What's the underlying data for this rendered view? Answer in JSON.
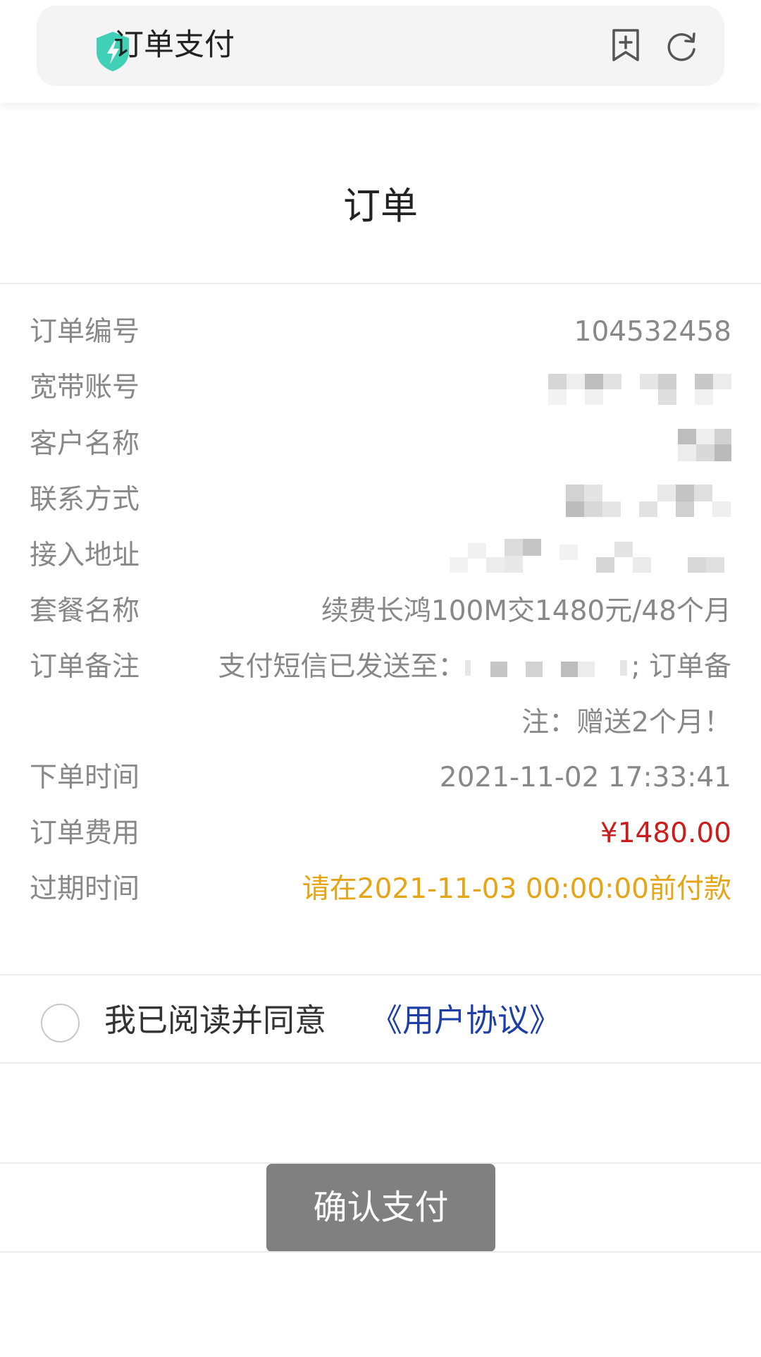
{
  "browser": {
    "page_title": "订单支付"
  },
  "order": {
    "heading": "订单",
    "fields": [
      {
        "label": "订单编号",
        "value": "104532458"
      },
      {
        "label": "宽带账号",
        "value": ""
      },
      {
        "label": "客户名称",
        "value": ""
      },
      {
        "label": "联系方式",
        "value": ""
      },
      {
        "label": "接入地址",
        "value": ""
      },
      {
        "label": "套餐名称",
        "value": "续费长鸿100M交1480元/48个月"
      },
      {
        "label": "订单备注",
        "value_line1_prefix": "支付短信已发送至：",
        "value_line1_suffix": "; 订单备",
        "value_line2": "注：赠送2个月！"
      },
      {
        "label": "下单时间",
        "value": "2021-11-02 17:33:41"
      },
      {
        "label": "订单费用",
        "value": "¥1480.00"
      },
      {
        "label": "过期时间",
        "value": "请在2021-11-03 00:00:00前付款"
      }
    ]
  },
  "agreement": {
    "text": "我已阅读并同意",
    "link": "《用户协议》"
  },
  "pay_button": {
    "label": "确认支付"
  },
  "colors": {
    "fee": "#cc1d1d",
    "expiry": "#e6a417",
    "link": "#1f3fa8",
    "button": "#808080",
    "shield": "#3fd0b6"
  }
}
